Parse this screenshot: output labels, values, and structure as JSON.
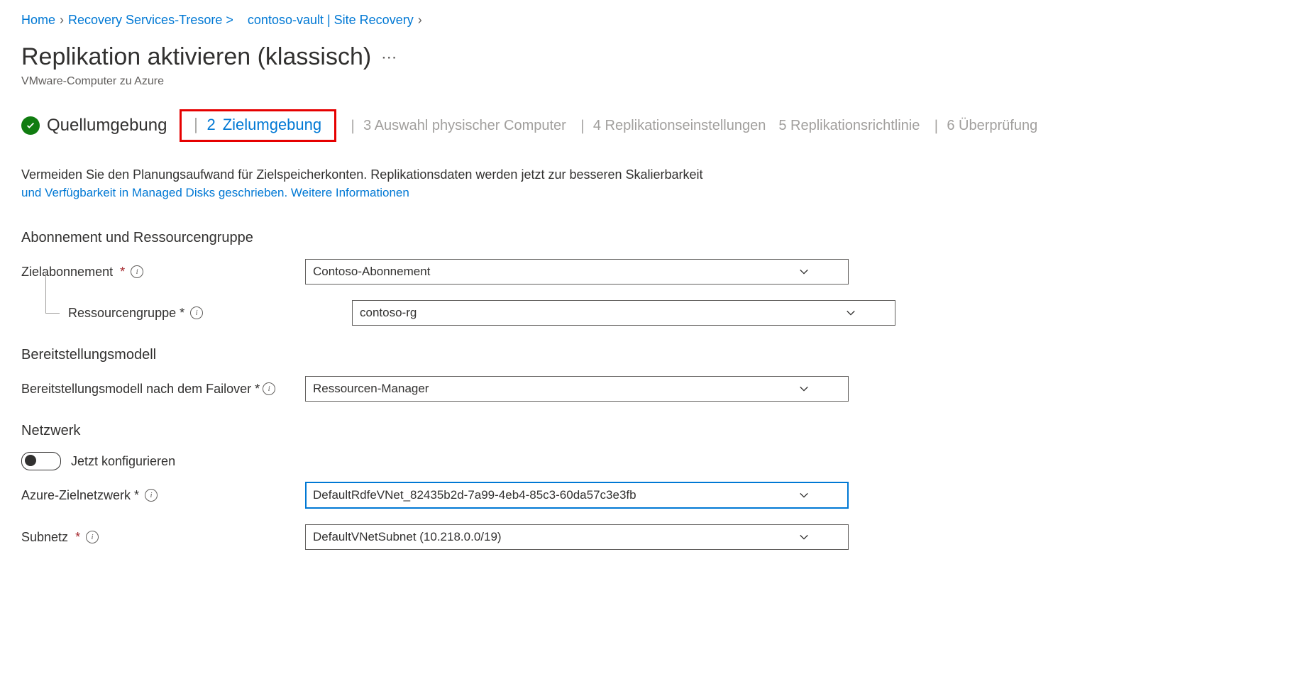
{
  "breadcrumb": {
    "home": "Home",
    "item1": "Recovery Services-Tresore",
    "item2": "contoso-vault | Site Recovery"
  },
  "page": {
    "title": "Replikation aktivieren (klassisch)",
    "subtitle": "VMware-Computer zu Azure"
  },
  "stepper": {
    "s1": "Quellumgebung",
    "s2_num": "2",
    "s2_label": "Zielumgebung",
    "s3": "3 Auswahl physischer Computer",
    "s4": "4 Replikationseinstellungen",
    "s5": "5 Replikationsrichtlinie",
    "s6": "6 Überprüfung"
  },
  "info": {
    "line1": "Vermeiden Sie den Planungsaufwand für Zielspeicherkonten. Replikationsdaten werden jetzt zur besseren Skalierbarkeit",
    "link": "und Verfügbarkeit in Managed Disks geschrieben. Weitere Informationen"
  },
  "sections": {
    "sub_rg_heading": "Abonnement und Ressourcengruppe",
    "target_sub_label": "Zielabonnement",
    "target_sub_value": "Contoso-Abonnement",
    "rg_label": "Ressourcengruppe *",
    "rg_value": "contoso-rg",
    "deploy_heading": "Bereitstellungsmodell",
    "deploy_label": "Bereitstellungsmodell nach dem Failover *",
    "deploy_value": "Ressourcen-Manager",
    "network_heading": "Netzwerk",
    "toggle_label": "Jetzt konfigurieren",
    "target_net_label": "Azure-Zielnetzwerk *",
    "target_net_value": "DefaultRdfeVNet_82435b2d-7a99-4eb4-85c3-60da57c3e3fb",
    "subnet_label": "Subnetz",
    "subnet_value": "DefaultVNetSubnet (10.218.0.0/19)"
  }
}
